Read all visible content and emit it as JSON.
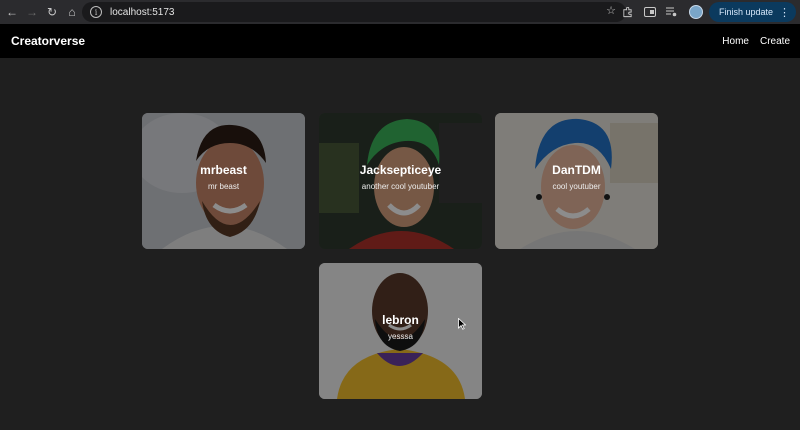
{
  "browser": {
    "url": "localhost:5173",
    "update_button": "Finish update"
  },
  "header": {
    "brand": "Creatorverse",
    "nav": [
      {
        "label": "Home"
      },
      {
        "label": "Create"
      }
    ]
  },
  "creators": [
    {
      "name": "mrbeast",
      "description": "mr beast"
    },
    {
      "name": "Jacksepticeye",
      "description": "another cool youtuber"
    },
    {
      "name": "DanTDM",
      "description": "cool youtuber"
    },
    {
      "name": "lebron",
      "description": "yesssa"
    }
  ],
  "colors": {
    "page_bg": "#1f1f1f",
    "header_bg": "#000000",
    "accent_update": "#0b3a5e"
  }
}
